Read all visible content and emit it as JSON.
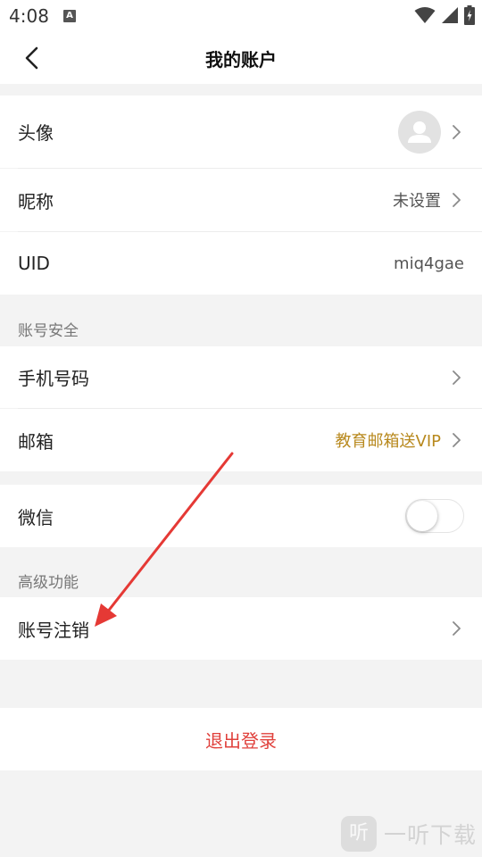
{
  "status_bar": {
    "time": "4:08",
    "notification_icon": "A"
  },
  "header": {
    "title": "我的账户",
    "back_icon": "chevron-left-icon"
  },
  "profile": {
    "avatar_label": "头像",
    "nickname_label": "昵称",
    "nickname_value": "未设置",
    "uid_label": "UID",
    "uid_value": "miq4gae"
  },
  "account_security": {
    "section_title": "账号安全",
    "phone_label": "手机号码",
    "email_label": "邮箱",
    "email_value": "教育邮箱送VIP",
    "wechat_label": "微信",
    "wechat_enabled": false
  },
  "advanced": {
    "section_title": "高级功能",
    "cancel_account_label": "账号注销"
  },
  "logout": {
    "label": "退出登录"
  },
  "watermark": {
    "logo_text": "听",
    "text": "一听下载"
  },
  "colors": {
    "background": "#f3f3f3",
    "logout_red": "#e0413c",
    "vip_gold": "#b8891e",
    "annotation_arrow": "#e53935"
  }
}
